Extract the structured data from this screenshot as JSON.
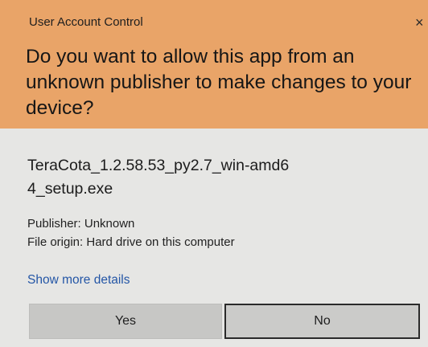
{
  "dialog": {
    "title": "User Account Control",
    "close_symbol": "×",
    "question": "Do you want to allow this app from an unknown publisher to make changes to your device?",
    "filename": "TeraCota_1.2.58.53_py2.7_win-amd64_setup.exe",
    "publisher": "Publisher: Unknown",
    "origin": "File origin: Hard drive on this computer",
    "details_link": "Show more details",
    "yes_label": "Yes",
    "no_label": "No"
  },
  "colors": {
    "header_bg": "#e9a468",
    "body_bg": "#e6e6e4",
    "link": "#2456a6"
  }
}
